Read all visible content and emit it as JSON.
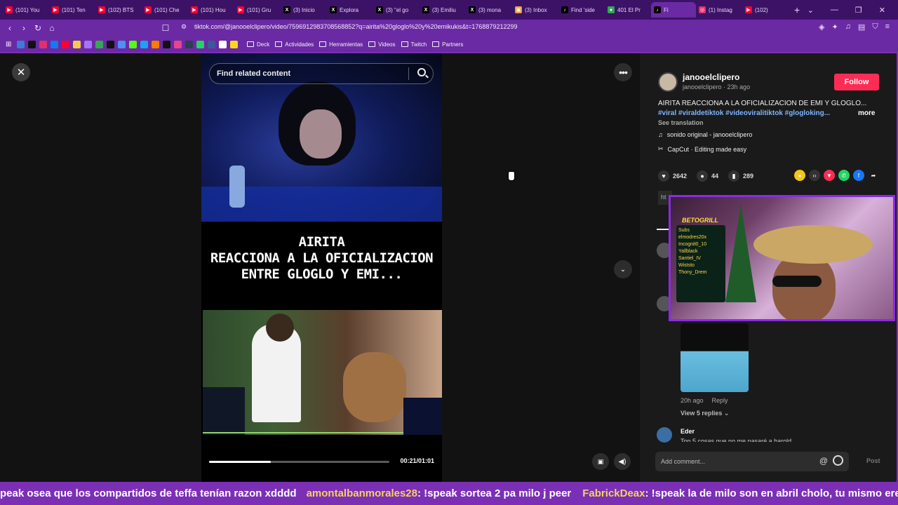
{
  "browser": {
    "tabs": [
      {
        "label": "(101) You",
        "color": "#ff0033",
        "glyph": "▶"
      },
      {
        "label": "(101) Ten",
        "color": "#ff0033",
        "glyph": "▶"
      },
      {
        "label": "(102) BTS",
        "color": "#ff0033",
        "glyph": "▶"
      },
      {
        "label": "(101) Che",
        "color": "#ff0033",
        "glyph": "▶"
      },
      {
        "label": "(101) Hou",
        "color": "#ff0033",
        "glyph": "▶"
      },
      {
        "label": "(101) Gru",
        "color": "#ff0033",
        "glyph": "▶"
      },
      {
        "label": "(3) Inicio",
        "color": "#000000",
        "glyph": "X"
      },
      {
        "label": "Explora",
        "color": "#000000",
        "glyph": "X"
      },
      {
        "label": "(3) \"el go",
        "color": "#000000",
        "glyph": "X"
      },
      {
        "label": "(3) Emiliu",
        "color": "#000000",
        "glyph": "X"
      },
      {
        "label": "(3) mona",
        "color": "#000000",
        "glyph": "X"
      },
      {
        "label": "(3) Inbox",
        "color": "#e8a33c",
        "glyph": "▣"
      },
      {
        "label": "Find 'side",
        "color": "#000000",
        "glyph": "♪"
      },
      {
        "label": "401 El Pr",
        "color": "#34a853",
        "glyph": "●"
      },
      {
        "label": "Fi",
        "color": "#000000",
        "glyph": "♪"
      },
      {
        "label": "(1) Instag",
        "color": "#e1306c",
        "glyph": "◎"
      },
      {
        "label": "(102)",
        "color": "#ff0033",
        "glyph": "▶"
      }
    ],
    "active_tab_index": 14,
    "url": "tiktok.com/@janooelclipero/video/7596912983708568852?q=airita%20gloglo%20y%20emikukis&t=1768879212299",
    "bookmarks": {
      "folders": [
        "Deck",
        "Actividades",
        "Herramientas",
        "Videos",
        "Twitch",
        "Partners"
      ]
    }
  },
  "video": {
    "search_placeholder": "Find related content",
    "title_lines": [
      "AIRITA",
      "REACCIONA A LA OFICIALIZACION",
      "ENTRE GLOGLO Y EMI..."
    ],
    "time": "00:21/01:01",
    "progress_fraction": 0.344
  },
  "post": {
    "username": "janooelclipero",
    "subline": "janooelclipero · 23h ago",
    "follow_label": "Follow",
    "description": "AIRITA REACCIONA A LA OFICIALIZACION DE EMI Y GLOGLO...",
    "hashtags": "#viral #viraldetiktok #videoviralitiktok #glogloking...",
    "more_label": "more",
    "see_translation": "See translation",
    "sound": "sonido original - janooelclipero",
    "capcut": "CapCut · Editing made easy",
    "likes": "2642",
    "comments": "44",
    "saves": "289",
    "link_stub": "ht"
  },
  "comments": {
    "time": "20h ago",
    "reply_label": "Reply",
    "view_replies": "View 5 replies",
    "next_author": "Eder",
    "next_text": "Top 5 cosas que no me pasaré a harold",
    "input_placeholder": "Add comment...",
    "post_label": "Post"
  },
  "webcam": {
    "logo_text": "BETOGRILL",
    "board_lines": [
      "Subs",
      "elmodres20x",
      "Incognit0_10",
      "Yallblack",
      "Santiel_IV",
      "Wiststo",
      "Thony_Drem"
    ]
  },
  "chat": {
    "lead_text": "peak osea que los compartidos de teffa tenían razon xdddd",
    "messages": [
      {
        "user": "amontalbanmorales28",
        "text": ": !speak sortea 2 pa milo j peer"
      },
      {
        "user": "FabrickDeax",
        "text": ": !speak la de milo son en abril cholo, tu mismo eres"
      }
    ]
  }
}
